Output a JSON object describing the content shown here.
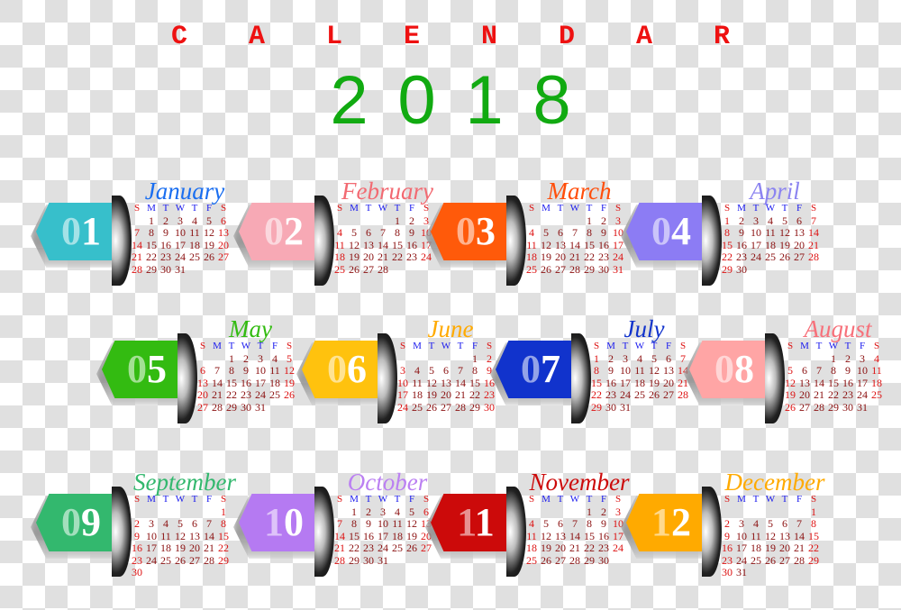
{
  "title_letters": [
    "C",
    "A",
    "L",
    "E",
    "N",
    "D",
    "A",
    "R"
  ],
  "year_digits": [
    "2",
    "0",
    "1",
    "8"
  ],
  "weekday_headers": [
    "S",
    "M",
    "T",
    "W",
    "T",
    "F",
    "S"
  ],
  "months": [
    {
      "name": "January",
      "num": "01",
      "color": "#37bfcb",
      "name_color": "#1a6ef0",
      "start": 1,
      "days": 31
    },
    {
      "name": "February",
      "num": "02",
      "color": "#f7a9b5",
      "name_color": "#f26a72",
      "start": 4,
      "days": 28
    },
    {
      "name": "March",
      "num": "03",
      "color": "#ff5a0a",
      "name_color": "#ff4e0a",
      "start": 4,
      "days": 31
    },
    {
      "name": "April",
      "num": "04",
      "color": "#8c7cf4",
      "name_color": "#8c84f0",
      "start": 0,
      "days": 30
    },
    {
      "name": "May",
      "num": "05",
      "color": "#33bb11",
      "name_color": "#33bb11",
      "start": 2,
      "days": 31
    },
    {
      "name": "June",
      "num": "06",
      "color": "#ffc20e",
      "name_color": "#ffaa00",
      "start": 5,
      "days": 30
    },
    {
      "name": "July",
      "num": "07",
      "color": "#1133cc",
      "name_color": "#1133cc",
      "start": 0,
      "days": 31
    },
    {
      "name": "August",
      "num": "08",
      "color": "#ffa5a5",
      "name_color": "#f7707a",
      "start": 3,
      "days": 31
    },
    {
      "name": "September",
      "num": "09",
      "color": "#33b86e",
      "name_color": "#33b86e",
      "start": 6,
      "days": 30
    },
    {
      "name": "October",
      "num": "10",
      "color": "#b57af2",
      "name_color": "#bb80f2",
      "start": 1,
      "days": 31
    },
    {
      "name": "November",
      "num": "11",
      "color": "#cc0a0a",
      "name_color": "#cc0a0a",
      "start": 4,
      "days": 30
    },
    {
      "name": "December",
      "num": "12",
      "color": "#ffaa00",
      "name_color": "#ffaa00",
      "start": 6,
      "days": 31
    }
  ]
}
